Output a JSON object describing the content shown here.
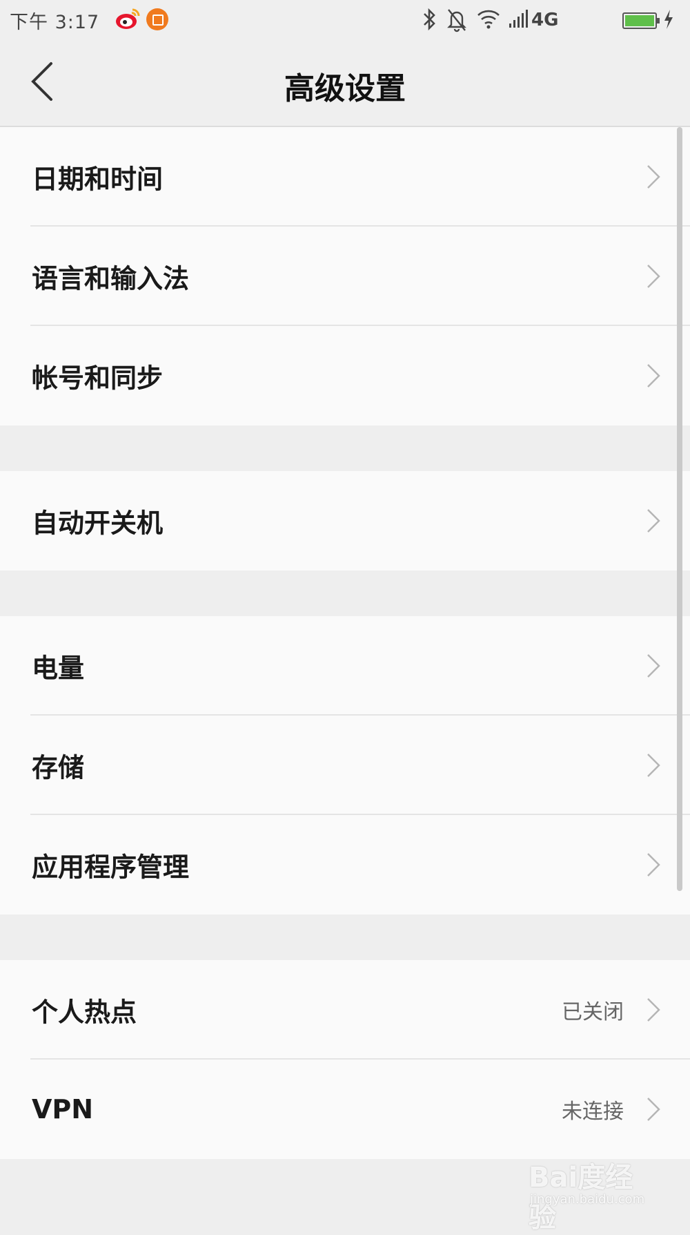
{
  "status_bar": {
    "time": "下午 3:17",
    "network": "4G",
    "icons": [
      "weibo-icon",
      "crop-app-icon",
      "bluetooth-icon",
      "bell-off-icon",
      "wifi-icon",
      "signal-icon",
      "battery-icon",
      "charging-icon"
    ],
    "battery_color": "#5fbf4a"
  },
  "header": {
    "title": "高级设置",
    "back_icon": "chevron-left-icon"
  },
  "groups": [
    {
      "items": [
        {
          "label": "日期和时间",
          "value": ""
        },
        {
          "label": "语言和输入法",
          "value": ""
        },
        {
          "label": "帐号和同步",
          "value": ""
        }
      ]
    },
    {
      "items": [
        {
          "label": "自动开关机",
          "value": ""
        }
      ]
    },
    {
      "items": [
        {
          "label": "电量",
          "value": ""
        },
        {
          "label": "存储",
          "value": ""
        },
        {
          "label": "应用程序管理",
          "value": ""
        }
      ]
    },
    {
      "items": [
        {
          "label": "个人热点",
          "value": "已关闭"
        },
        {
          "label": "VPN",
          "value": "未连接"
        }
      ]
    }
  ],
  "watermark": {
    "text": "Bai度经验",
    "url": "jingyan.baidu.com"
  },
  "colors": {
    "background": "#eeeeee",
    "row_background": "#fafafa",
    "accent_orange": "#f07a1e",
    "weibo_red": "#e6162d"
  }
}
